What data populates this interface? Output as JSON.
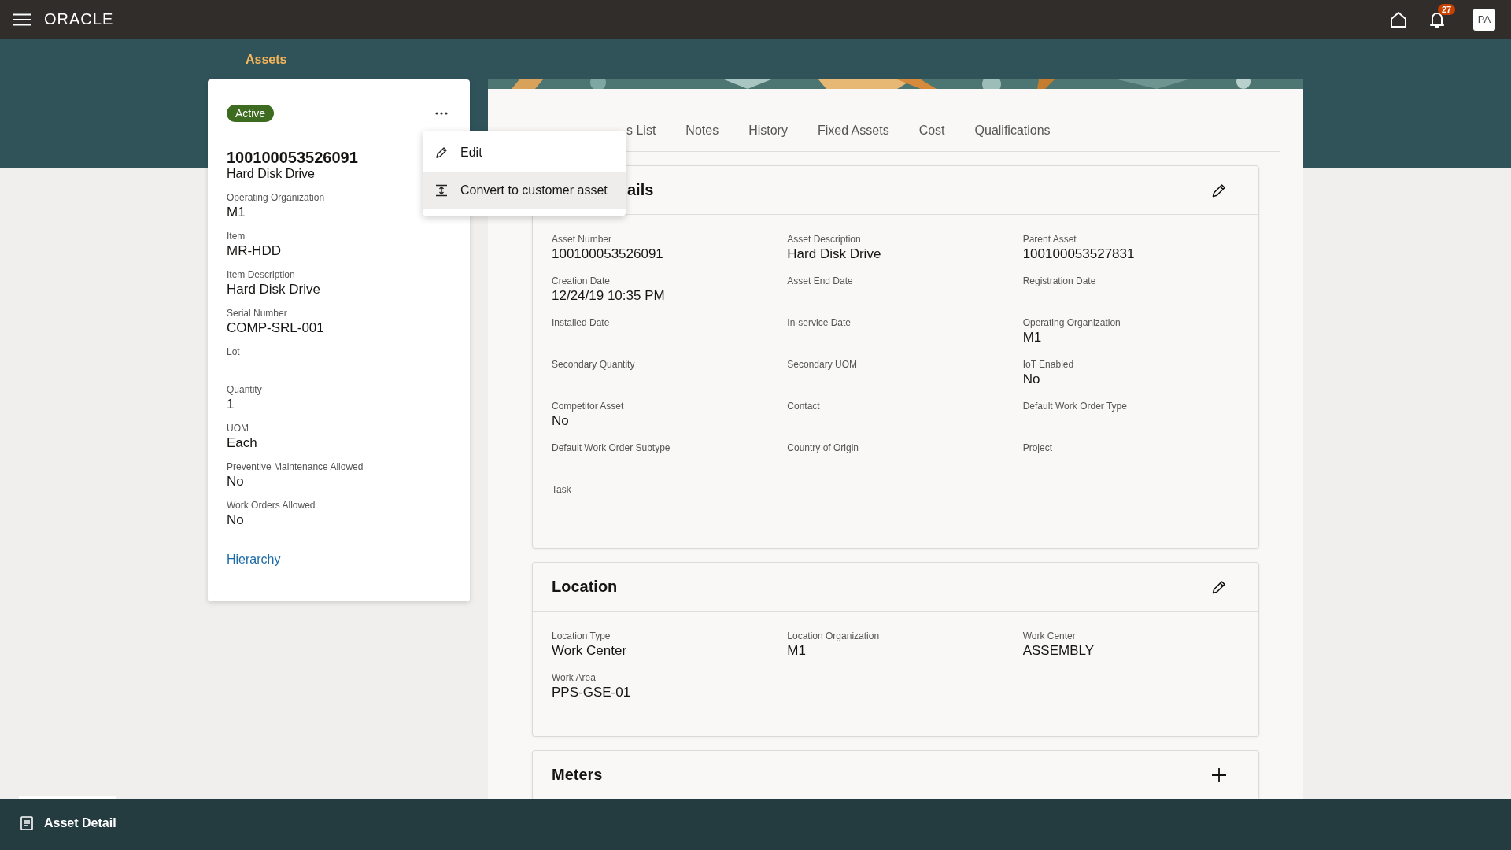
{
  "header": {
    "brand": "ORACLE",
    "notification_count": "27",
    "avatar": "PA"
  },
  "breadcrumb": "Assets",
  "summary": {
    "status": "Active",
    "asset_number": "100100053526091",
    "description": "Hard Disk Drive",
    "fields": [
      {
        "label": "Operating Organization",
        "value": "M1"
      },
      {
        "label": "Item",
        "value": "MR-HDD"
      },
      {
        "label": "Item Description",
        "value": "Hard Disk Drive"
      },
      {
        "label": "Serial Number",
        "value": "COMP-SRL-001"
      },
      {
        "label": "Lot"
      },
      {
        "label": "Quantity",
        "value": "1"
      },
      {
        "label": "UOM",
        "value": "Each"
      },
      {
        "label": "Preventive Maintenance Allowed",
        "value": "No"
      },
      {
        "label": "Work Orders Allowed",
        "value": "No"
      }
    ],
    "link": "Hierarchy"
  },
  "actions_menu": [
    {
      "label": "Edit",
      "kind": "edit",
      "selected": false
    },
    {
      "label": "Convert to customer asset",
      "kind": "convert",
      "selected": true
    }
  ],
  "tabs": [
    {
      "label": "s List",
      "selected": false
    },
    {
      "label": "Notes",
      "selected": false
    },
    {
      "label": "History",
      "selected": false
    },
    {
      "label": "Fixed Assets",
      "selected": false
    },
    {
      "label": "Cost",
      "selected": false
    },
    {
      "label": "Qualifications",
      "selected": false
    }
  ],
  "sections": [
    {
      "title": "ails",
      "kind": "edit",
      "fields": [
        {
          "label": "Asset Number",
          "value": "100100053526091"
        },
        {
          "label": "Asset Description",
          "value": "Hard Disk Drive"
        },
        {
          "label": "Parent Asset",
          "value": "100100053527831"
        },
        {
          "label": "Creation Date",
          "value": "12/24/19 10:35 PM"
        },
        {
          "label": "Asset End Date"
        },
        {
          "label": "Registration Date"
        },
        {
          "label": "Installed Date"
        },
        {
          "label": "In-service Date"
        },
        {
          "label": "Operating Organization",
          "value": "M1"
        },
        {
          "label": "Secondary Quantity"
        },
        {
          "label": "Secondary UOM"
        },
        {
          "label": "IoT Enabled",
          "value": "No"
        },
        {
          "label": "Competitor Asset",
          "value": "No"
        },
        {
          "label": "Contact"
        },
        {
          "label": "Default Work Order Type"
        },
        {
          "label": "Default Work Order Subtype"
        },
        {
          "label": "Country of Origin"
        },
        {
          "label": "Project"
        },
        {
          "label": "Task"
        }
      ]
    },
    {
      "title": "Location",
      "kind": "edit",
      "fields": [
        {
          "label": "Location Type",
          "value": "Work Center"
        },
        {
          "label": "Location Organization",
          "value": "M1"
        },
        {
          "label": "Work Center",
          "value": "ASSEMBLY"
        },
        {
          "label": "Work Area",
          "value": "PPS-GSE-01"
        }
      ]
    },
    {
      "title": "Meters",
      "kind": "add"
    }
  ],
  "footer_tab": "Asset Detail"
}
